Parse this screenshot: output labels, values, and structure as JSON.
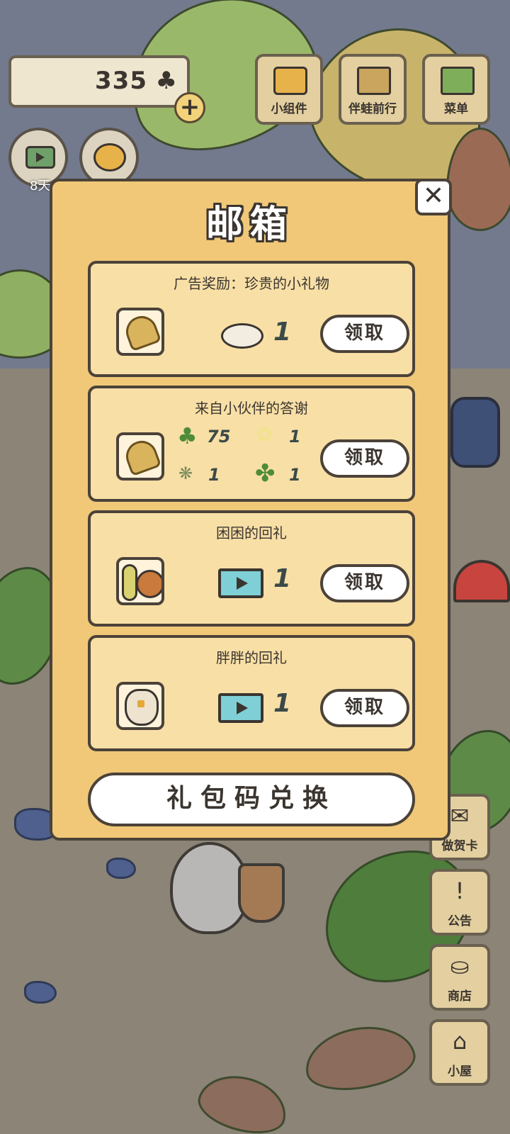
{
  "hud": {
    "clover_count": "335",
    "clover_icon": "♣",
    "plus_label": "+",
    "days_label": "8天"
  },
  "top_menu": [
    {
      "label": "小组件",
      "icon": "widget-icon"
    },
    {
      "label": "伴蛙前行",
      "icon": "journey-icon"
    },
    {
      "label": "菜单",
      "icon": "menu-icon"
    }
  ],
  "side_menu": [
    {
      "label": "做贺卡",
      "icon": "card-icon",
      "glyph": "✉"
    },
    {
      "label": "公告",
      "icon": "notice-icon",
      "glyph": "!"
    },
    {
      "label": "商店",
      "icon": "shop-icon",
      "glyph": "⛀"
    },
    {
      "label": "小屋",
      "icon": "house-icon",
      "glyph": "⌂"
    }
  ],
  "mailbox": {
    "title": "邮箱",
    "close_label": "✕",
    "claim_label": "领取",
    "redeem_label": "礼包码兑换",
    "mails": [
      {
        "title": "广告奖励：珍贵的小礼物",
        "thumb": "bell-icon",
        "items": [
          {
            "icon": "food-plate-icon",
            "qty": "1"
          }
        ]
      },
      {
        "title": "来自小伙伴的答谢",
        "thumb": "bell-icon",
        "items": [
          {
            "icon": "clover-icon",
            "qty": "75"
          },
          {
            "icon": "flower-icon",
            "qty": "1"
          },
          {
            "icon": "herb-icon",
            "qty": "1"
          },
          {
            "icon": "four-leaf-clover-icon",
            "qty": "1"
          }
        ]
      },
      {
        "title": "困困的回礼",
        "thumb": "snail-icon",
        "items": [
          {
            "icon": "video-icon",
            "qty": "1"
          }
        ]
      },
      {
        "title": "胖胖的回礼",
        "thumb": "owl-icon",
        "items": [
          {
            "icon": "video-icon",
            "qty": "1"
          }
        ]
      }
    ]
  },
  "colors": {
    "panel": "#f0c878",
    "card": "#f8dfa6",
    "outline": "#4b4239",
    "button": "#ffffff"
  }
}
